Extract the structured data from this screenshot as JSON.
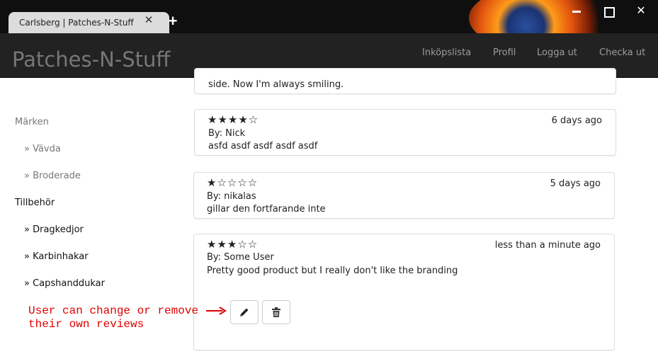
{
  "browser": {
    "tab_title": "Carlsberg | Patches-N-Stuff",
    "tab_close": "✕",
    "new_tab": "+"
  },
  "navbar": {
    "brand": "Patches-N-Stuff",
    "links": [
      "Inköpslista",
      "Profil",
      "Logga ut",
      "Checka ut"
    ]
  },
  "sidebar": {
    "groups": [
      {
        "label": "Märken",
        "items": [
          "» Vävda",
          "» Broderade"
        ]
      },
      {
        "label": "Tillbehör",
        "items": [
          "» Dragkedjor",
          "» Karbinhakar",
          "» Capshanddukar"
        ]
      }
    ]
  },
  "reviews": [
    {
      "partial_text": "side. Now I'm always smiling."
    },
    {
      "stars": "★★★★☆",
      "rating": 4,
      "ago": "6 days ago",
      "by": "By: Nick",
      "text": "asfd asdf asdf asdf asdf"
    },
    {
      "stars": "★☆☆☆☆",
      "rating": 1,
      "ago": "5 days ago",
      "by": "By: nikalas",
      "text": "gillar den fortfarande inte"
    },
    {
      "stars": "★★★☆☆",
      "rating": 3,
      "ago": "less than a minute ago",
      "by": "By: Some User",
      "text": "Pretty good product but I really don't like the branding",
      "edit_icon": "pencil-icon",
      "delete_icon": "trash-icon"
    }
  ],
  "annotation": {
    "text": "User can change or remove\ntheir own reviews",
    "color": "#e00000"
  }
}
